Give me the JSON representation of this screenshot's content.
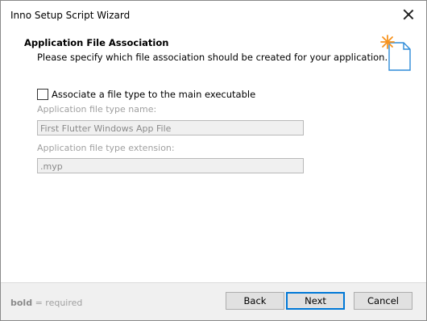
{
  "window": {
    "title": "Inno Setup Script Wizard"
  },
  "header": {
    "title": "Application File Association",
    "subtitle": "Please specify which file association should be created for your application."
  },
  "form": {
    "checkbox_label": "Associate a file type to the main executable",
    "checkbox_checked": false,
    "type_name_label": "Application file type name:",
    "type_name_value": "First Flutter Windows App File",
    "type_ext_label": "Application file type extension:",
    "type_ext_value": ".myp"
  },
  "footer": {
    "required_bold": "bold",
    "required_text": "= required",
    "back_label": "Back",
    "next_label": "Next",
    "cancel_label": "Cancel"
  },
  "icons": {
    "wizard": "wizard-sparkle-document-icon",
    "close": "close-icon"
  },
  "colors": {
    "accent": "#0078d7",
    "sparkle": "#f7931e",
    "doc": "#2e8bd8"
  }
}
